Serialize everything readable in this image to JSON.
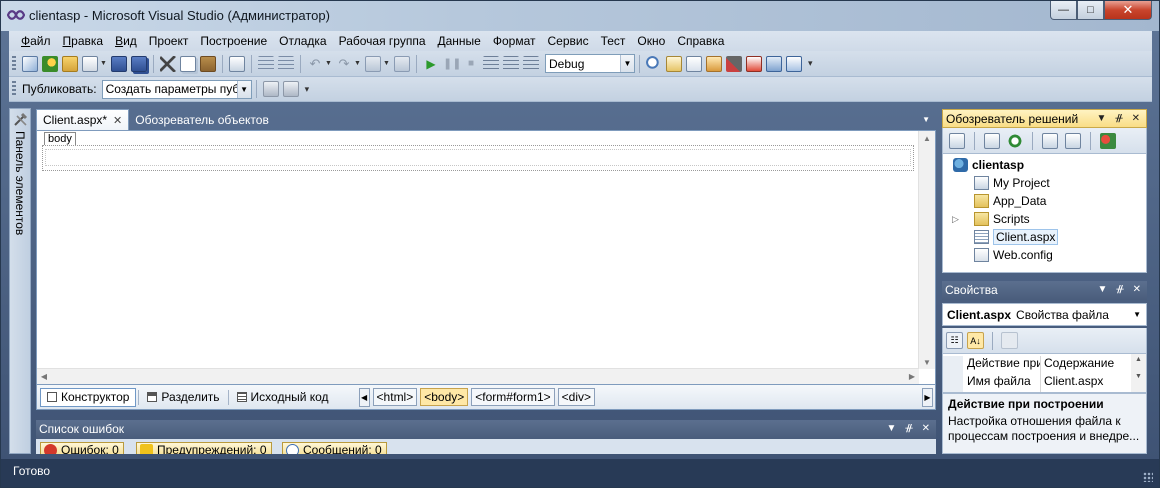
{
  "window": {
    "title": "clientasp - Microsoft Visual Studio (Администратор)",
    "min_label": "—",
    "max_label": "□",
    "close_label": "✕"
  },
  "menu": [
    {
      "u": "Ф",
      "rest": "айл"
    },
    {
      "u": "П",
      "rest": "равка"
    },
    {
      "u": "В",
      "rest": "ид"
    },
    {
      "u": "",
      "rest": "Проект"
    },
    {
      "u": "",
      "rest": "Построение"
    },
    {
      "u": "",
      "rest": "Отладка"
    },
    {
      "u": "",
      "rest": "Рабочая группа"
    },
    {
      "u": "",
      "rest": "Данные"
    },
    {
      "u": "",
      "rest": "Формат"
    },
    {
      "u": "",
      "rest": "Сервис"
    },
    {
      "u": "",
      "rest": "Тест"
    },
    {
      "u": "",
      "rest": "Окно"
    },
    {
      "u": "",
      "rest": "Справка"
    }
  ],
  "toolbar": {
    "config_value": "Debug",
    "publish_label": "Публиковать:",
    "publish_value": "Создать параметры пуб"
  },
  "toolbox": {
    "label": "Панель элементов"
  },
  "documents": {
    "tabs": [
      {
        "label": "Client.aspx*",
        "active": true,
        "close": "✕"
      },
      {
        "label": "Обозреватель объектов",
        "active": false
      }
    ],
    "body_tag": "body"
  },
  "view_bar": {
    "design": "Конструктор",
    "split": "Разделить",
    "source": "Исходный код",
    "crumbs": [
      "<html>",
      "<body>",
      "<form#form1>",
      "<div>"
    ],
    "selected_crumb": "<body>",
    "nav_left": "◀",
    "nav_right": "▶"
  },
  "error_list": {
    "title": "Список ошибок",
    "tabs": [
      "Ошибок: 0",
      "Предупреждений: 0",
      "Сообщений: 0"
    ]
  },
  "solution_explorer": {
    "title": "Обозреватель решений",
    "root": "clientasp",
    "items": [
      "My Project",
      "App_Data",
      "Scripts",
      "Client.aspx",
      "Web.config"
    ],
    "selected": "Client.aspx"
  },
  "properties": {
    "title": "Свойства",
    "object_name": "Client.aspx",
    "object_type": "Свойства файла",
    "rows": [
      {
        "name": "Действие при построении",
        "value": "Содержание"
      },
      {
        "name": "Имя файла",
        "value": "Client.aspx"
      }
    ],
    "desc_title": "Действие при построении",
    "desc_text": "Настройка отношения файла к процессам построения и внедре..."
  },
  "status": {
    "text": "Готово"
  },
  "pane_buttons": {
    "menu": "▼",
    "pin": "ᚌ",
    "close": "✕"
  },
  "colors": {
    "accent": "#ffe8a6",
    "chrome": "#2b3b58"
  }
}
